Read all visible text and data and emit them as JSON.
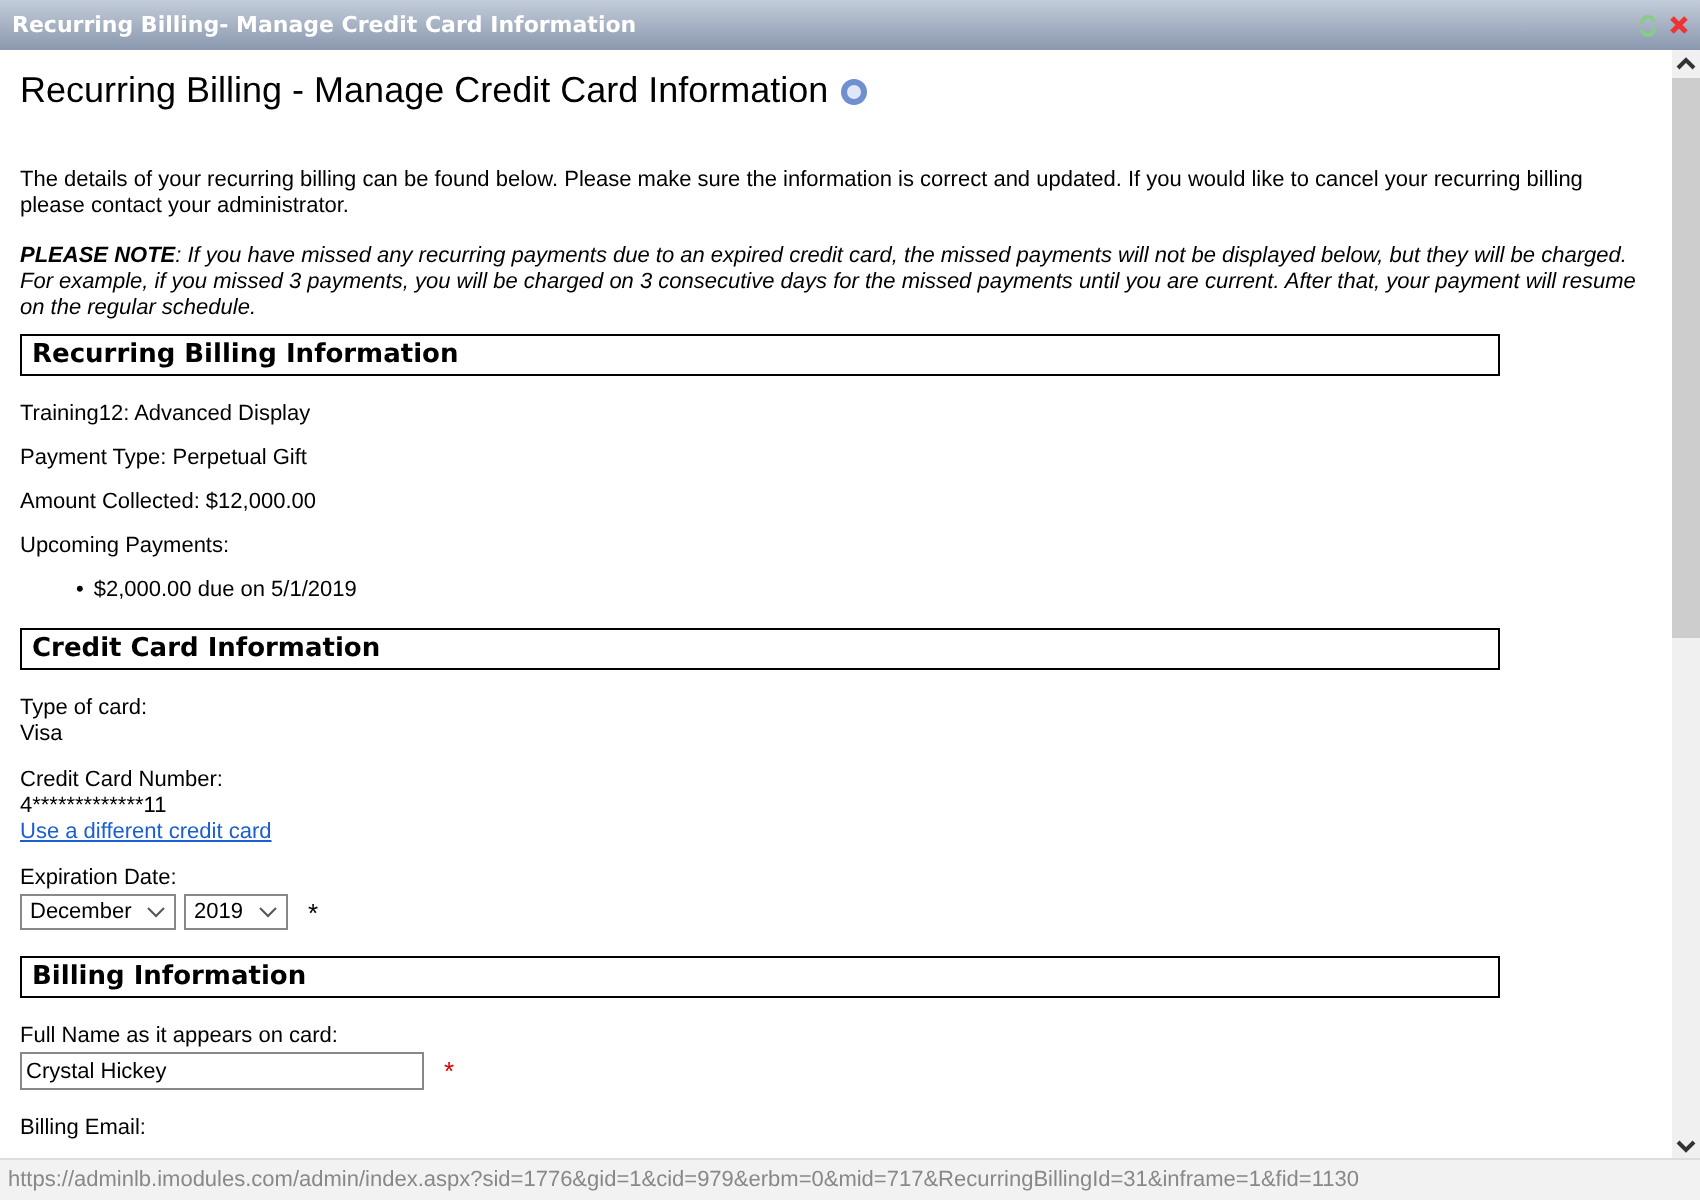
{
  "window": {
    "title": "Recurring Billing- Manage Credit Card Information"
  },
  "page": {
    "heading": "Recurring Billing - Manage Credit Card Information",
    "intro": "The details of your recurring billing can be found below.  Please make sure the information is correct and updated.  If you would like to cancel your recurring billing please contact your administrator.",
    "note": "**PLEASE NOTE**:  If you have missed any recurring payments due to an expired credit card, the missed payments will not be displayed below, but they will be charged. For example, if you missed 3 payments, you will be charged on 3 consecutive days for the missed payments until you are current.  After that, your payment will resume on the regular schedule."
  },
  "recurring_billing": {
    "title": "Recurring Billing Information",
    "lines": [
      "Training12: Advanced Display",
      "Payment Type: Perpetual Gift",
      "Amount Collected: $12,000.00"
    ],
    "upcoming_label": "Upcoming Payments:",
    "upcoming": [
      {
        "bullet": "•",
        "text": "$2,000.00 due on 5/1/2019"
      }
    ]
  },
  "credit_card": {
    "title": "Credit Card Information",
    "type_label": "Type of card:",
    "type_value": "Visa",
    "number_label": "Credit Card Number:",
    "number_value": "4*************11",
    "change_link": "Use a different credit card",
    "expiration_label": "Expiration Date:",
    "month": "December",
    "year": "2019",
    "required_mark": "*"
  },
  "billing": {
    "title": "Billing Information",
    "name_label": "Full Name as it appears on card:",
    "name_value": "Crystal Hickey",
    "required_mark": "*",
    "email_label": "Billing Email:"
  },
  "status_bar": {
    "url": "https://adminlb.imodules.com/admin/index.aspx?sid=1776&gid=1&cid=979&erbm=0&mid=717&RecurringBillingId=31&inframe=1&fid=1130"
  }
}
